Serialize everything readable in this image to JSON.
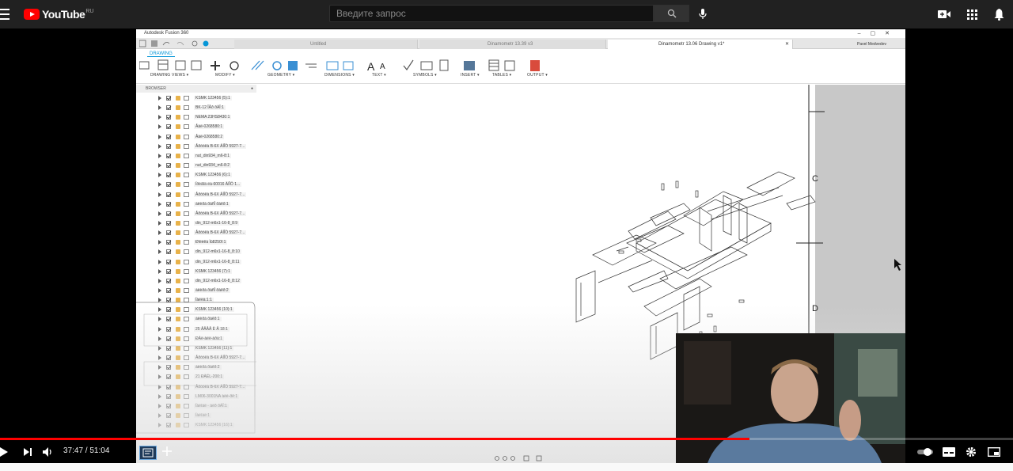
{
  "youtube": {
    "logo_text": "YouTube",
    "region": "RU",
    "search_placeholder": "Введите запрос"
  },
  "fusion": {
    "app_title": "Autodesk Fusion 360",
    "tabs": [
      {
        "label": "Untitled"
      },
      {
        "label": "Dinamometr 13.39 v3"
      },
      {
        "label": "Dinamometr 13.06 Drawing v1*"
      }
    ],
    "user": "Pavel Medvedev",
    "ribbon_tab": "DRAWING",
    "ribbon_groups": [
      "DRAWING VIEWS ▾",
      "MODIFY ▾",
      "GEOMETRY ▾",
      "DIMENSIONS ▾",
      "TEXT ▾",
      "SYMBOLS ▾",
      "INSERT ▾",
      "TABLES ▾",
      "OUTPUT ▾"
    ],
    "browser_title": "BROWSER",
    "browser_items": [
      "KSMK 123456 (5):1",
      "BK-12 ÎÂð ðÀÎ:1",
      "NEMA 23HS8430:1",
      "Âàë-0268580:1",
      "Âàë-0268580:2",
      "Âðóòêà B-6X ÄÍÎÖ 5927-7...",
      "nut_din934_m6-8:1",
      "nut_din934_m6-8:2",
      "KSMK 123456 (6):1",
      "Ïðèâîä ëà-60016 ÄÍÎÖ 1...",
      "Âðóòêà B-6X ÄÍÎÖ 5927-7...",
      "àëèðà ðàñÎ ðàêð:1",
      "Âðóòêà B-6X ÄÍÎÖ 5927-7...",
      "din_912-m6x1-16-8_8:9",
      "Âðóòêà B-6X ÄÍÎÖ 5927-7...",
      "Ðîëèêà Ìû8250î:1",
      "din_912-m6x1-16-8_8:10",
      "din_912-m6x1-16-8_8:11",
      "KSMK 123456 (7):1",
      "din_912-m6x1-16-8_8:12",
      "àëèðà ðàñÎ ðàêð:2",
      "Ïàëëà:1:1",
      "KSMK 123456 (10):1",
      "àëèðà ðàêð:1",
      "25 ÂÂÂÂ Ë Â 18:1",
      "ÐÀë-àëë-àðà:1",
      "KSMK 123456 (11):1",
      "Âðóòêà B-6X ÄÍÎÖ 5927-7...",
      "àëèðà ðàêð:2",
      "21 ÐÀËL-200:1",
      "Âðóòêà B-6X ÄÍÎÖ 5927-7...",
      "LM06-3001NA àëè-ðê:1",
      "Ïàëìàë - àëð ðÀÎ:1",
      "Ïàëìàë:1",
      "KSMK 123456 (16):1"
    ],
    "sheet_zone_labels": [
      "C",
      "D"
    ]
  },
  "player": {
    "time_current": "37:47",
    "time_total": "51:04",
    "time_separator": " / ",
    "progress": 0.74
  },
  "colors": {
    "yt_red": "#ff0000",
    "fusion_blue": "#0696d7"
  }
}
